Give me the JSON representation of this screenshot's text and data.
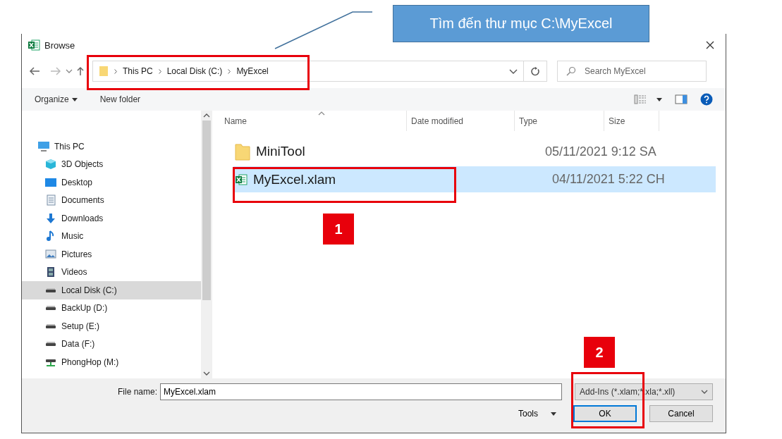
{
  "callout": {
    "text": "Tìm đến thư mục C:\\MyExcel"
  },
  "window": {
    "title": "Browse"
  },
  "breadcrumb": [
    "This PC",
    "Local Disk (C:)",
    "MyExcel"
  ],
  "search": {
    "placeholder": "Search MyExcel"
  },
  "commands": [
    "Organize",
    "New folder"
  ],
  "columns": [
    "Name",
    "Date modified",
    "Type",
    "Size"
  ],
  "sidebar": {
    "items": [
      {
        "label": "This PC",
        "kind": "pc",
        "selected": false,
        "children": [
          {
            "label": "3D Objects",
            "kind": "cube",
            "selected": false
          },
          {
            "label": "Desktop",
            "kind": "desktop",
            "selected": false
          },
          {
            "label": "Documents",
            "kind": "document",
            "selected": false
          },
          {
            "label": "Downloads",
            "kind": "download",
            "selected": false
          },
          {
            "label": "Music",
            "kind": "music",
            "selected": false
          },
          {
            "label": "Pictures",
            "kind": "picture",
            "selected": false
          },
          {
            "label": "Videos",
            "kind": "video",
            "selected": false
          },
          {
            "label": "Local Disk (C:)",
            "kind": "drive",
            "selected": true
          },
          {
            "label": "BackUp (D:)",
            "kind": "drive",
            "selected": false
          },
          {
            "label": "Setup (E:)",
            "kind": "drive",
            "selected": false
          },
          {
            "label": "Data (F:)",
            "kind": "drive",
            "selected": false
          },
          {
            "label": "PhongHop (M:)",
            "kind": "network",
            "selected": false
          }
        ]
      }
    ]
  },
  "files": [
    {
      "name": "MiniTool",
      "date": "05/11/2021 9:12 SA",
      "kind": "folder",
      "selected": false
    },
    {
      "name": "MyExcel.xlam",
      "date": "04/11/2021 5:22 CH",
      "kind": "excel",
      "selected": true
    }
  ],
  "file_name": {
    "label": "File name:",
    "value": "MyExcel.xlam"
  },
  "filter": {
    "value": "Add-Ins (*.xlam;*.xla;*.xll)"
  },
  "tools": "Tools",
  "buttons": [
    "OK",
    "Cancel"
  ],
  "badges": [
    "1",
    "2"
  ]
}
